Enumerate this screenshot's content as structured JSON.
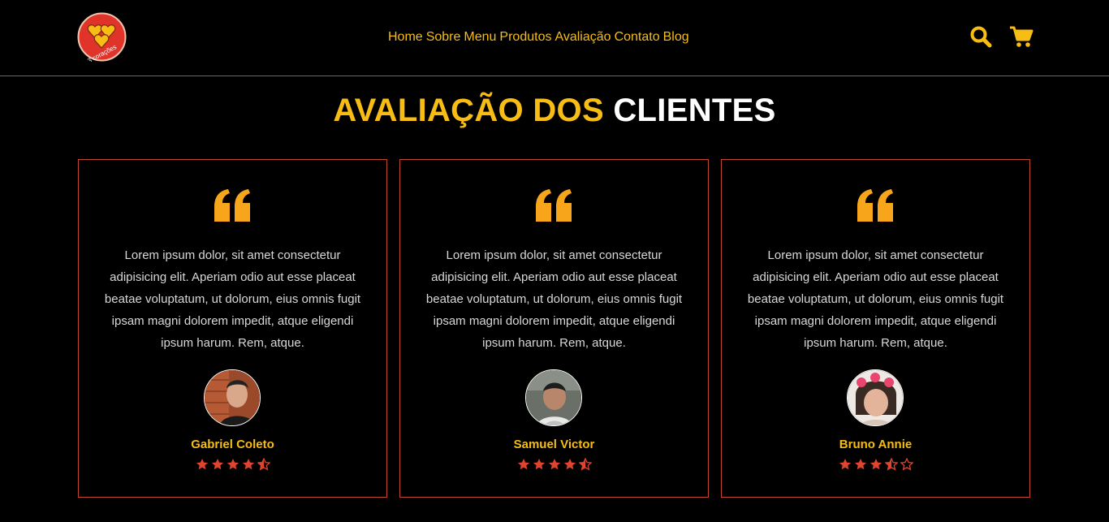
{
  "brand": {
    "logo_text": "3 corações"
  },
  "nav": {
    "items": [
      "Home",
      "Sobre",
      "Menu",
      "Produtos",
      "Avaliação",
      "Contato",
      "Blog"
    ]
  },
  "header_icons": [
    "search-icon",
    "cart-icon"
  ],
  "section": {
    "title_accent": "AVALIAÇÃO DOS",
    "title_rest": "CLIENTES"
  },
  "colors": {
    "accent": "#f7bd14",
    "border": "#c0462f",
    "star": "#e0442e",
    "background": "#000000"
  },
  "reviews": [
    {
      "text": "Lorem ipsum dolor, sit amet consectetur adipisicing elit. Aperiam odio aut esse placeat beatae voluptatum, ut dolorum, eius omnis fugit ipsam magni dolorem impedit, atque eligendi ipsum harum. Rem, atque.",
      "name": "Gabriel Coleto",
      "rating": 4.5
    },
    {
      "text": "Lorem ipsum dolor, sit amet consectetur adipisicing elit. Aperiam odio aut esse placeat beatae voluptatum, ut dolorum, eius omnis fugit ipsam magni dolorem impedit, atque eligendi ipsum harum. Rem, atque.",
      "name": "Samuel Victor",
      "rating": 4.5
    },
    {
      "text": "Lorem ipsum dolor, sit amet consectetur adipisicing elit. Aperiam odio aut esse placeat beatae voluptatum, ut dolorum, eius omnis fugit ipsam magni dolorem impedit, atque eligendi ipsum harum. Rem, atque.",
      "name": "Bruno Annie",
      "rating": 3.5
    }
  ]
}
